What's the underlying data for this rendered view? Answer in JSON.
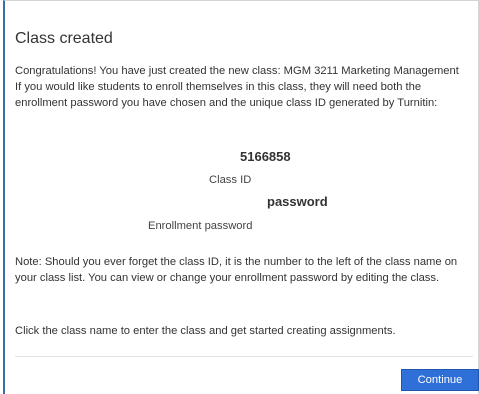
{
  "dialog": {
    "title": "Class created",
    "intro_line1": "Congratulations! You have just created the new class: MGM 3211 Marketing Management",
    "intro_line2": "If you would like students to enroll themselves in this class, they will need both the enrollment password you have chosen and the unique class ID generated by Turnitin:",
    "class_id_value": "5166858",
    "class_id_label": "Class ID",
    "password_value": "password",
    "password_label": "Enrollment password",
    "note": "Note: Should you ever forget the class ID, it is the number to the left of the class name on your class list. You can view or change your enrollment password by editing the class.",
    "cta": "Click the class name to enter the class and get started creating assignments.",
    "continue_label": "Continue"
  },
  "colors": {
    "button": "#2f6fd8",
    "left_border": "#3b6ea5"
  }
}
